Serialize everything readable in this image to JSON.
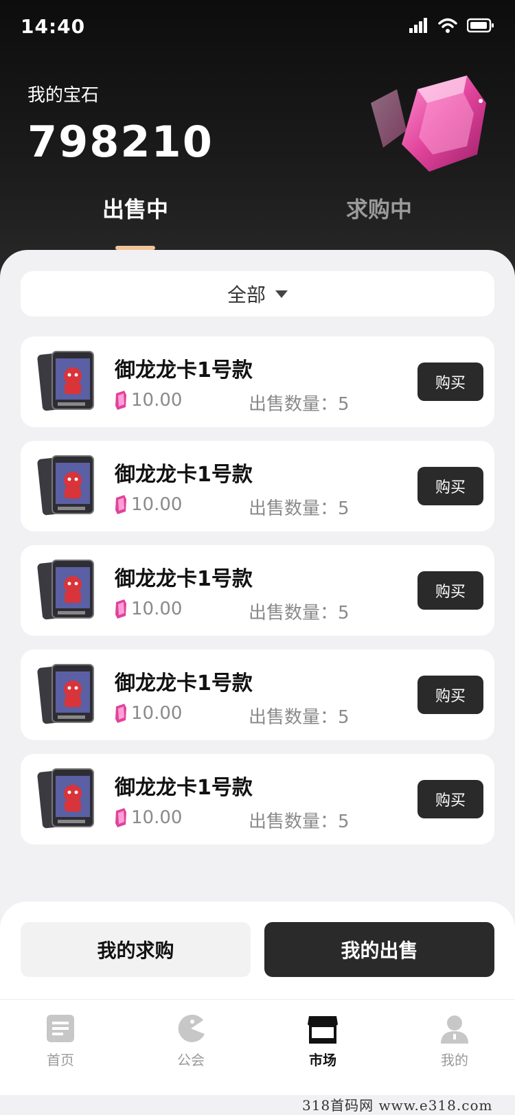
{
  "status_bar": {
    "time": "14:40",
    "icons": [
      "signal-icon",
      "wifi-icon",
      "battery-icon"
    ]
  },
  "header": {
    "balance_label": "我的宝石",
    "balance_value": "798210",
    "gem_icon": "pink-gem-icon"
  },
  "tabs": [
    {
      "label": "出售中",
      "active": true
    },
    {
      "label": "求购中",
      "active": false
    }
  ],
  "filter": {
    "label": "全部"
  },
  "listings": [
    {
      "title": "御龙龙卡1号款",
      "price": "10.00",
      "qty_label": "出售数量：5",
      "buy_label": "购买"
    },
    {
      "title": "御龙龙卡1号款",
      "price": "10.00",
      "qty_label": "出售数量：5",
      "buy_label": "购买"
    },
    {
      "title": "御龙龙卡1号款",
      "price": "10.00",
      "qty_label": "出售数量：5",
      "buy_label": "购买"
    },
    {
      "title": "御龙龙卡1号款",
      "price": "10.00",
      "qty_label": "出售数量：5",
      "buy_label": "购买"
    },
    {
      "title": "御龙龙卡1号款",
      "price": "10.00",
      "qty_label": "出售数量：5",
      "buy_label": "购买"
    }
  ],
  "actions": {
    "my_buy": "我的求购",
    "my_sell": "我的出售"
  },
  "tabbar": [
    {
      "label": "首页",
      "icon": "home-doc-icon",
      "active": false
    },
    {
      "label": "公会",
      "icon": "guild-icon",
      "active": false
    },
    {
      "label": "市场",
      "icon": "market-store-icon",
      "active": true
    },
    {
      "label": "我的",
      "icon": "profile-icon",
      "active": false
    }
  ],
  "watermark": "318首码网  www.e318.com",
  "colors": {
    "accent_indicator": "#f1c49a",
    "dark_button": "#2a2a2a",
    "gem_pink": "#e0439b"
  }
}
